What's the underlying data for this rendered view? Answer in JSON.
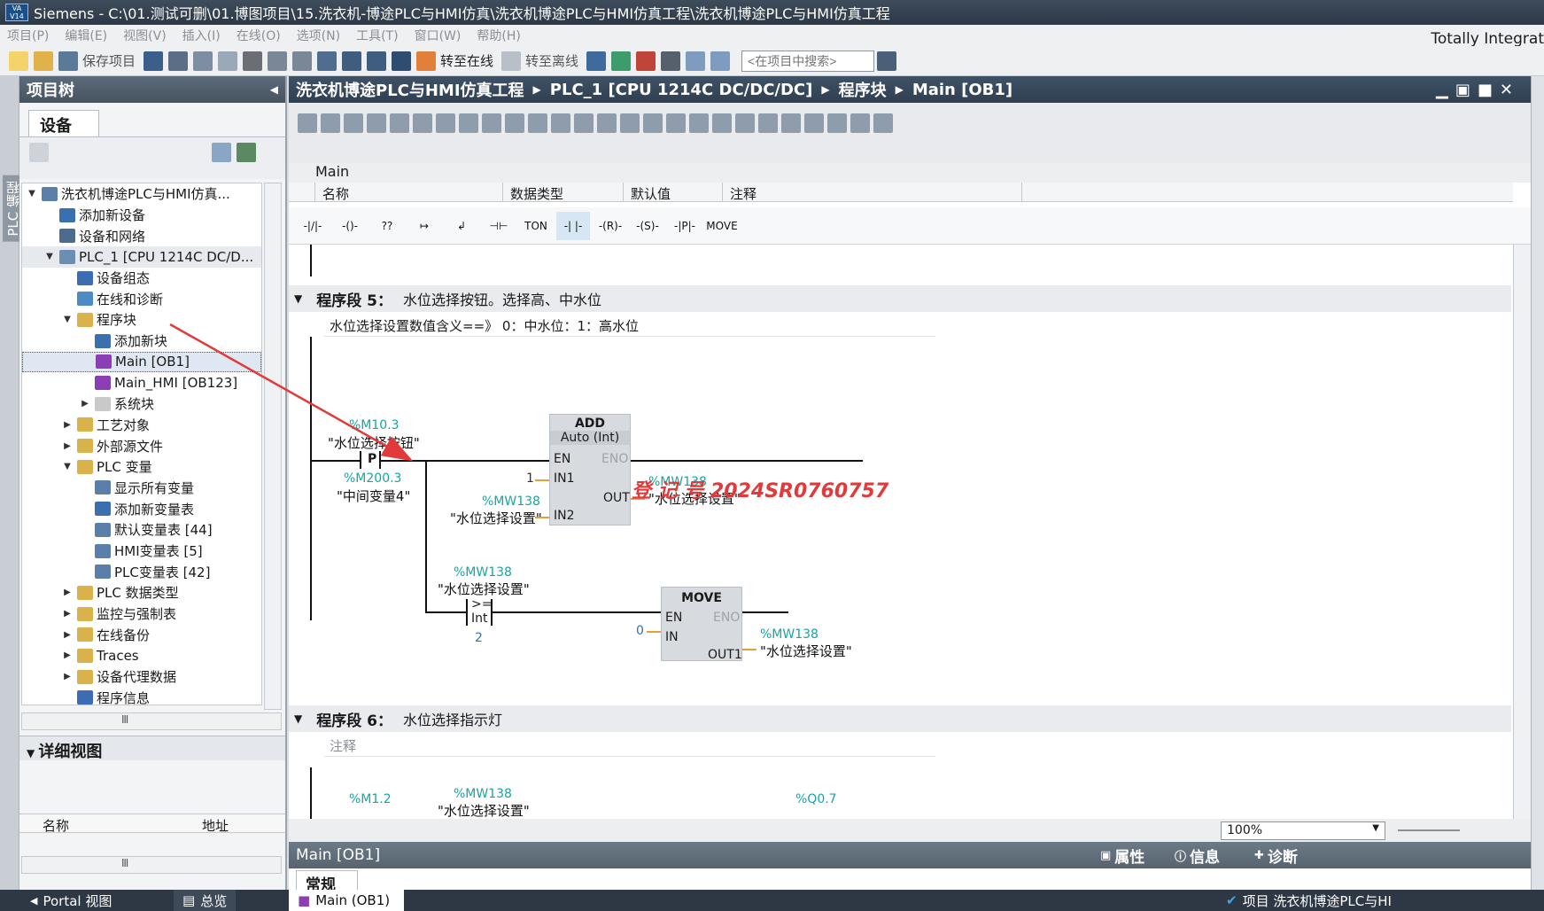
{
  "window": {
    "title": "Siemens  -  C:\\01.测试可删\\01.博图项目\\15.洗衣机-博途PLC与HMI仿真\\洗衣机博途PLC与HMI仿真工程\\洗衣机博途PLC与HMI仿真工程",
    "logo_top": "VA",
    "logo_bottom": "V14",
    "brand": "Totally Integrat"
  },
  "menu": [
    "项目(P)",
    "编辑(E)",
    "视图(V)",
    "插入(I)",
    "在线(O)",
    "选项(N)",
    "工具(T)",
    "窗口(W)",
    "帮助(H)"
  ],
  "toolbar": {
    "save_label": "保存项目",
    "go_online": "转至在线",
    "go_offline": "转至离线",
    "search_placeholder": "<在项目中搜索>"
  },
  "plc_strip": "PLC 编程",
  "project_tree": {
    "title": "项目树",
    "tab": "设备",
    "items": [
      {
        "label": "洗衣机博途PLC与HMI仿真...",
        "indent": 0,
        "arrow": "▼",
        "icon": "project-icon",
        "color": "#5b7fa8"
      },
      {
        "label": "添加新设备",
        "indent": 1,
        "arrow": "",
        "icon": "add-device-icon",
        "color": "#3a6fb0"
      },
      {
        "label": "设备和网络",
        "indent": 1,
        "arrow": "",
        "icon": "network-icon",
        "color": "#4d6b8c"
      },
      {
        "label": "PLC_1 [CPU 1214C DC/D...",
        "indent": 1,
        "arrow": "▼",
        "icon": "cpu-icon",
        "color": "#6a8fb3",
        "highlight": true
      },
      {
        "label": "设备组态",
        "indent": 2,
        "arrow": "",
        "icon": "device-config-icon",
        "color": "#3c6db3"
      },
      {
        "label": "在线和诊断",
        "indent": 2,
        "arrow": "",
        "icon": "diagnostics-icon",
        "color": "#4c8bc4"
      },
      {
        "label": "程序块",
        "indent": 2,
        "arrow": "▼",
        "icon": "folder-icon",
        "color": "#d9b24c"
      },
      {
        "label": "添加新块",
        "indent": 3,
        "arrow": "",
        "icon": "add-block-icon",
        "color": "#3a6fb0"
      },
      {
        "label": "Main [OB1]",
        "indent": 3,
        "arrow": "",
        "icon": "ob-icon",
        "color": "#8b3fb3",
        "selected": true
      },
      {
        "label": "Main_HMI [OB123]",
        "indent": 3,
        "arrow": "",
        "icon": "ob-icon",
        "color": "#8b3fb3"
      },
      {
        "label": "系统块",
        "indent": 3,
        "arrow": "▶",
        "icon": "folder-icon",
        "color": "#c9c9c9"
      },
      {
        "label": "工艺对象",
        "indent": 2,
        "arrow": "▶",
        "icon": "tech-object-icon",
        "color": "#d9b24c"
      },
      {
        "label": "外部源文件",
        "indent": 2,
        "arrow": "▶",
        "icon": "source-file-icon",
        "color": "#d9b24c"
      },
      {
        "label": "PLC 变量",
        "indent": 2,
        "arrow": "▼",
        "icon": "folder-icon",
        "color": "#d9b24c"
      },
      {
        "label": "显示所有变量",
        "indent": 3,
        "arrow": "",
        "icon": "tag-table-icon",
        "color": "#5a7fa8"
      },
      {
        "label": "添加新变量表",
        "indent": 3,
        "arrow": "",
        "icon": "add-tag-table-icon",
        "color": "#3a6fb0"
      },
      {
        "label": "默认变量表 [44]",
        "indent": 3,
        "arrow": "",
        "icon": "tag-table-icon",
        "color": "#5a7fa8"
      },
      {
        "label": "HMI变量表 [5]",
        "indent": 3,
        "arrow": "",
        "icon": "tag-table-icon",
        "color": "#5a7fa8"
      },
      {
        "label": "PLC变量表 [42]",
        "indent": 3,
        "arrow": "",
        "icon": "tag-table-icon",
        "color": "#5a7fa8"
      },
      {
        "label": "PLC 数据类型",
        "indent": 2,
        "arrow": "▶",
        "icon": "datatype-icon",
        "color": "#d9b24c"
      },
      {
        "label": "监控与强制表",
        "indent": 2,
        "arrow": "▶",
        "icon": "watch-table-icon",
        "color": "#d9b24c"
      },
      {
        "label": "在线备份",
        "indent": 2,
        "arrow": "▶",
        "icon": "backup-icon",
        "color": "#d9b24c"
      },
      {
        "label": "Traces",
        "indent": 2,
        "arrow": "▶",
        "icon": "traces-icon",
        "color": "#d9b24c"
      },
      {
        "label": "设备代理数据",
        "indent": 2,
        "arrow": "▶",
        "icon": "proxy-data-icon",
        "color": "#d9b24c"
      },
      {
        "label": "程序信息",
        "indent": 2,
        "arrow": "",
        "icon": "program-info-icon",
        "color": "#3c6db3"
      }
    ],
    "hscroll_glyph": "Ⅲ"
  },
  "detail_view": {
    "title": "详细视图",
    "col_name": "名称",
    "col_address": "地址"
  },
  "editor": {
    "breadcrumb": [
      "洗衣机博途PLC与HMI仿真工程",
      "PLC_1 [CPU 1214C DC/DC/DC]",
      "程序块",
      "Main [OB1]"
    ],
    "interface_title": "Main",
    "interface_cols": [
      "名称",
      "数据类型",
      "默认值",
      "注释"
    ],
    "ladder_buttons": [
      "-|/|-",
      "-()-",
      "??",
      "↦",
      "↲",
      "⊣⊢",
      "TON",
      "-| |-",
      "-(R)-",
      "-(S)-",
      "-|P|-",
      "MOVE"
    ],
    "network5": {
      "label": "程序段 5：",
      "title": "水位选择按钮。选择高、中水位",
      "comment": "水位选择设置数值含义==》  0：中水位：1：高水位",
      "contact_addr": "%M10.3",
      "contact_name": "\"水位选择按钮\"",
      "contact_type": "P",
      "edge_addr": "%M200.3",
      "edge_name": "\"中间变量4\"",
      "add_title": "ADD",
      "add_type": "Auto (Int)",
      "en": "EN",
      "eno": "ENO",
      "in1": "IN1",
      "in2": "IN2",
      "out": "OUT",
      "in1_value": "1",
      "in2_addr": "%MW138",
      "in2_name": "\"水位选择设置\"",
      "out_addr": "%MW138",
      "out_name": "\"水位选择设置\"",
      "cmp_addr": "%MW138",
      "cmp_name": "\"水位选择设置\"",
      "cmp_op": ">=",
      "cmp_type": "Int",
      "cmp_value": "2",
      "move_title": "MOVE",
      "move_in": "IN",
      "move_out": "OUT1",
      "move_in_value": "0",
      "move_out_addr": "%MW138",
      "move_out_name": "\"水位选择设置\""
    },
    "network6": {
      "label": "程序段 6：",
      "title": "水位选择指示灯",
      "comment": "注释",
      "addr1": "%M1.2",
      "addr2": "%MW138",
      "addr2_name": "\"水位选择设置\"",
      "addr3": "%Q0.7"
    },
    "watermark": "登 记 号  2024SR0760757",
    "zoom": "100%",
    "block_name": "Main [OB1]",
    "inspector": {
      "properties": "属性",
      "info": "信息",
      "diagnostics": "诊断"
    },
    "general_tab": "常规"
  },
  "statusbar": {
    "portal": "Portal 视图",
    "overview": "总览",
    "main_tab": "Main (OB1)",
    "project_status": "项目 洗衣机博途PLC与HI"
  },
  "colors": {
    "accent_red": "#e23a3a",
    "tag_teal": "#1aa3a3",
    "ob_purple": "#8b3fb3"
  }
}
